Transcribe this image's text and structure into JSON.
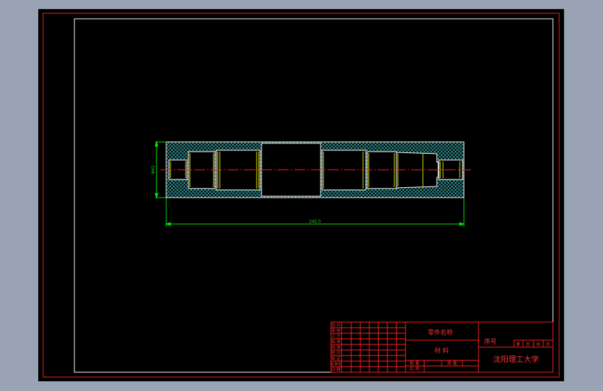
{
  "colors": {
    "background": "#99a3b3",
    "canvas": "#000000",
    "outer_border": "#ff2020",
    "inner_border": "#ffffff",
    "part_outline": "#ffffff",
    "part_fill": "#000000",
    "hatch": "#3aa6a6",
    "yellow": "#e6e600",
    "centerline": "#ff2020",
    "dimension": "#00e600",
    "title_lines": "#ff2020",
    "title_text": "#ff3030"
  },
  "drawing": {
    "dim_diameter": "Φ42",
    "dim_length": "242.5"
  },
  "title_block": {
    "part_name": "零件名称",
    "material": "材 料",
    "seq_no": "序号",
    "school": "沈阳理工大学",
    "sheet_cols": [
      "第",
      "页",
      "共",
      "页"
    ],
    "left_labels": [
      "设 计",
      "审 核",
      "工 艺",
      "标 准",
      "批 准",
      "校 对",
      "审 定",
      "标准化",
      "日 期"
    ],
    "bottom_labels": [
      "数 量",
      "比 例",
      "质 量"
    ]
  }
}
